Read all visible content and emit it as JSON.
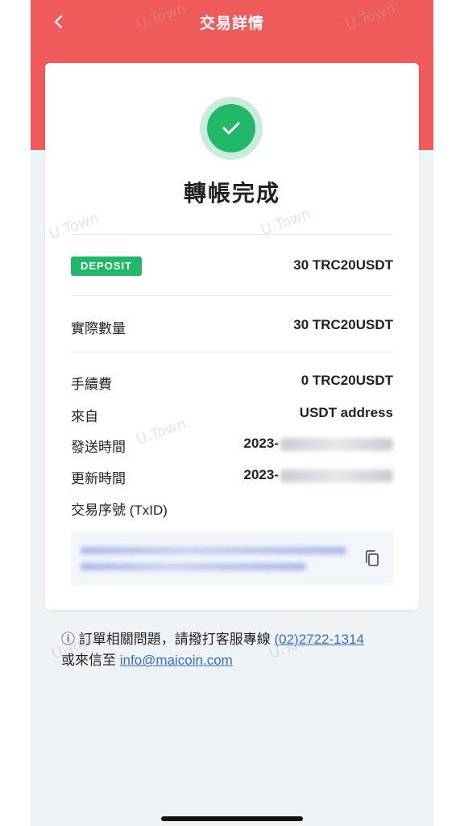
{
  "header": {
    "title": "交易詳情",
    "back_icon": "chevron-left-icon"
  },
  "status": {
    "icon": "check-circle-icon",
    "text": "轉帳完成",
    "color": "#22b86a"
  },
  "transaction": {
    "type_badge": "DEPOSIT",
    "amount": "30 TRC20USDT",
    "rows": [
      {
        "label": "實際數量",
        "value": "30 TRC20USDT"
      },
      {
        "label": "手續費",
        "value": "0 TRC20USDT"
      },
      {
        "label": "來自",
        "value": "USDT address"
      },
      {
        "label": "發送時間",
        "value": "2023-"
      },
      {
        "label": "更新時間",
        "value": "2023-"
      }
    ],
    "txid_label": "交易序號 (TxID)",
    "copy_icon": "copy-icon"
  },
  "footer_note": {
    "info_icon": "info-icon",
    "text_before": "訂單相關問題，請撥打客服專線",
    "phone": "(02)2722-1314",
    "text_mid": "或來信至",
    "email": "info@maicoin.com"
  },
  "watermark": "U.Town",
  "colors": {
    "header": "#ef5a5a",
    "accent_green": "#22b86a",
    "link": "#2f6fc5",
    "background": "#f0f3f6"
  }
}
